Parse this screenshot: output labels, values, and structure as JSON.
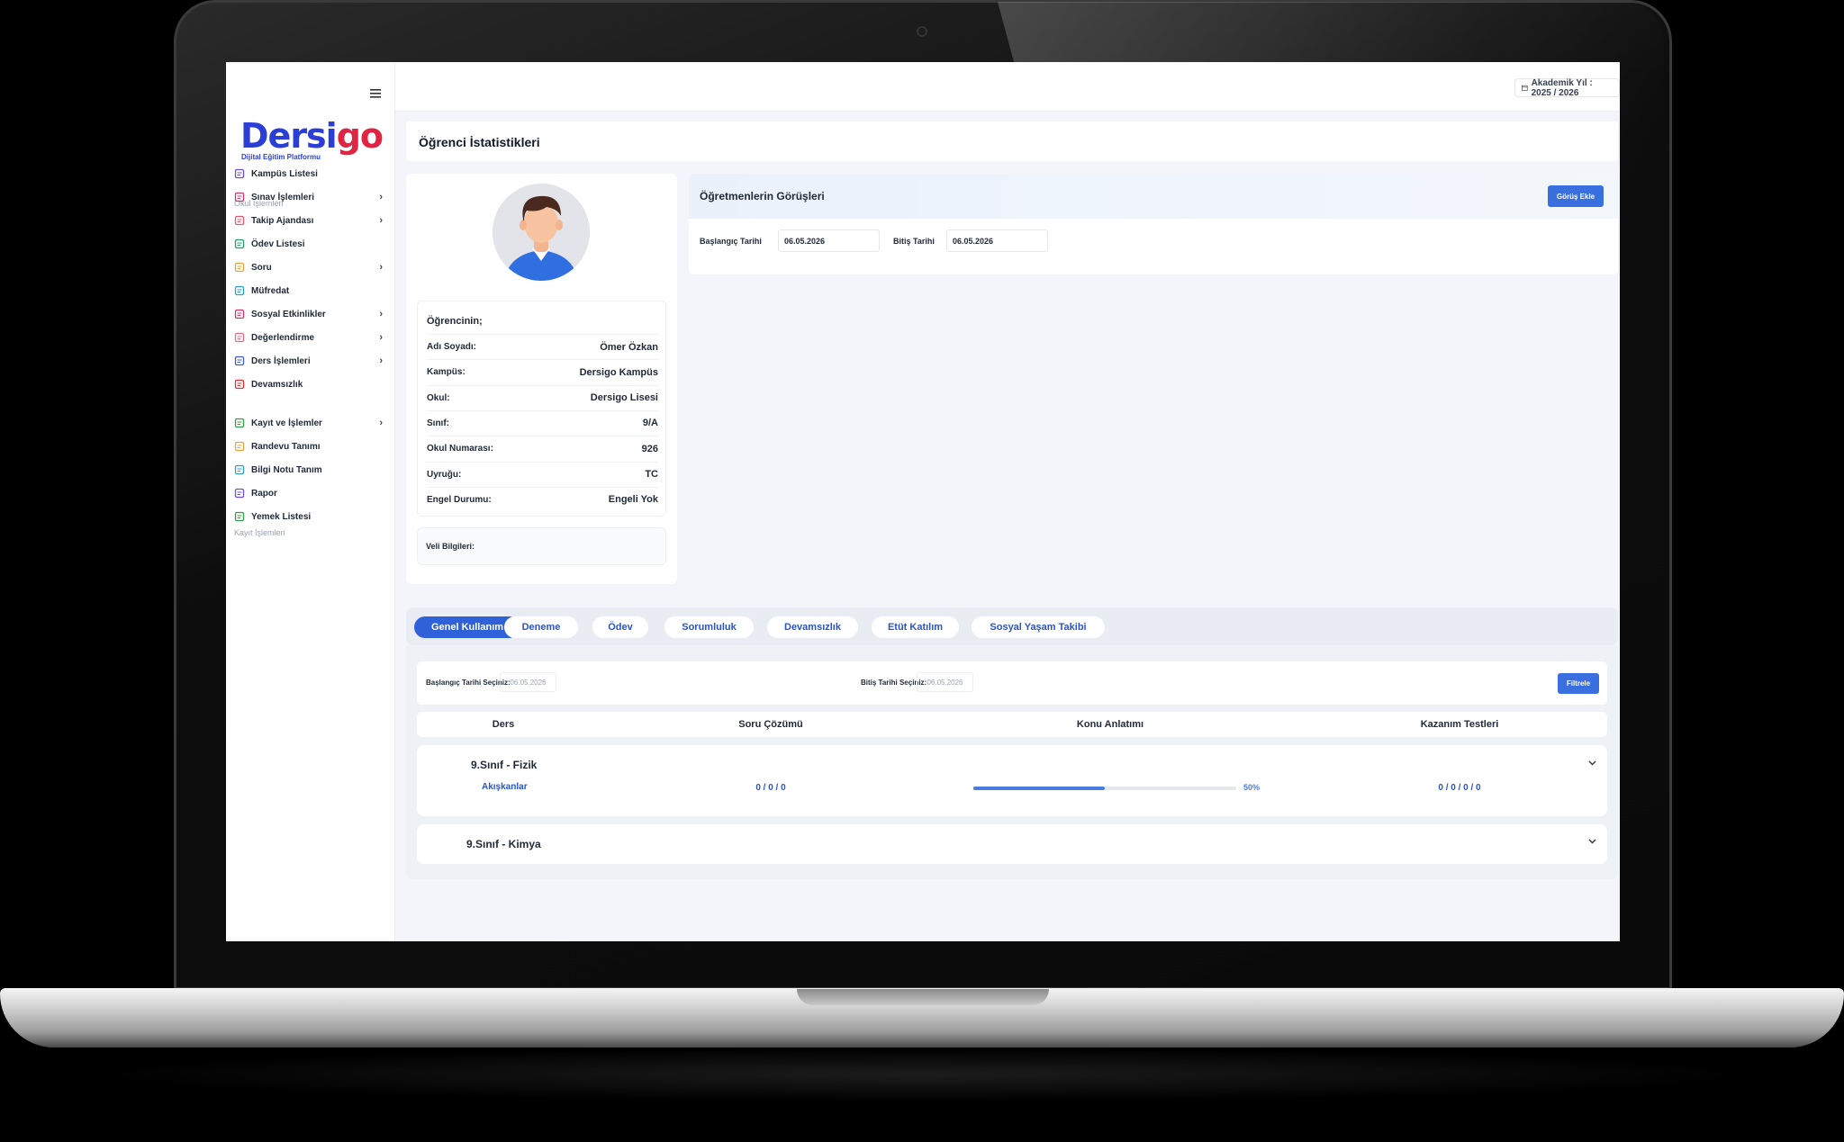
{
  "colors": {
    "brand_blue": "#2b3fd6",
    "brand_red": "#e02443",
    "primary": "#2f62d8"
  },
  "logo": {
    "part1": "Dersi",
    "part2": "go",
    "subtitle": "Dijital Eğitim Platformu"
  },
  "sidebar": {
    "section_school": "Okul İşlemleri",
    "section_registration": "Kayıt İşlemleri",
    "items": [
      {
        "label": "Kampüs Listesi",
        "icon": "building-icon",
        "chevron": false
      },
      {
        "label": "Sınav İşlemleri",
        "icon": "exam-icon",
        "chevron": true
      },
      {
        "label": "Takip Ajandası",
        "icon": "list-icon",
        "chevron": true
      },
      {
        "label": "Ödev Listesi",
        "icon": "homework-icon",
        "chevron": false
      },
      {
        "label": "Soru",
        "icon": "question-icon",
        "chevron": true
      },
      {
        "label": "Müfredat",
        "icon": "curriculum-icon",
        "chevron": false
      },
      {
        "label": "Sosyal Etkinlikler",
        "icon": "calendar-icon",
        "chevron": true
      },
      {
        "label": "Değerlendirme",
        "icon": "edit-icon",
        "chevron": true
      },
      {
        "label": "Ders İşlemleri",
        "icon": "book-icon",
        "chevron": true
      },
      {
        "label": "Devamsızlık",
        "icon": "absence-icon",
        "chevron": false
      },
      {
        "label": "Kayıt ve İşlemler",
        "icon": "user-add-icon",
        "chevron": true
      },
      {
        "label": "Randevu Tanımı",
        "icon": "appointment-icon",
        "chevron": false
      },
      {
        "label": "Bilgi Notu Tanım",
        "icon": "note-icon",
        "chevron": false
      },
      {
        "label": "Rapor",
        "icon": "report-icon",
        "chevron": false
      },
      {
        "label": "Yemek Listesi",
        "icon": "food-icon",
        "chevron": false
      }
    ]
  },
  "topbar": {
    "academic_year": "Akademik Yıl : 2025 / 2026"
  },
  "page": {
    "title": "Öğrenci İstatistikleri"
  },
  "student": {
    "heading": "Öğrencinin;",
    "rows": [
      {
        "label": "Adı Soyadı:",
        "value": "Ömer Özkan"
      },
      {
        "label": "Kampüs:",
        "value": "Dersigo Kampüs"
      },
      {
        "label": "Okul:",
        "value": "Dersigo Lisesi"
      },
      {
        "label": "Sınıf:",
        "value": "9/A"
      },
      {
        "label": "Okul Numarası:",
        "value": "926"
      },
      {
        "label": "Uyruğu:",
        "value": "TC"
      },
      {
        "label": "Engel Durumu:",
        "value": "Engeli Yok"
      }
    ],
    "parent_label": "Veli Bilgileri:"
  },
  "opinions": {
    "title": "Öğretmenlerin Görüşleri",
    "add_button": "Görüş Ekle",
    "start_label": "Başlangıç Tarihi",
    "start_value": "06.05.2026",
    "end_label": "Bitiş Tarihi",
    "end_value": "06.05.2026"
  },
  "tabs": [
    "Genel Kullanım",
    "Deneme",
    "Ödev",
    "Sorumluluk",
    "Devamsızlık",
    "Etüt Katılım",
    "Sosyal Yaşam Takibi"
  ],
  "filter": {
    "start_label": "Başlangıç Tarihi Seçiniz:",
    "start_value": "06.05.2026",
    "end_label": "Bitiş Tarihi Seçiniz:",
    "end_value": "06.05.2026",
    "button": "Filtrele"
  },
  "table": {
    "headers": [
      "Ders",
      "Soru Çözümü",
      "Konu Anlatımı",
      "Kazanım Testleri"
    ],
    "courses": [
      {
        "title": "9.Sınıf - Fizik",
        "expanded": true,
        "subject": "Akışkanlar",
        "question_solving": "0 / 0 / 0",
        "topic_progress": 0.5,
        "topic_progress_label": "50%",
        "achievement_tests": "0 / 0 / 0 / 0"
      },
      {
        "title": "9.Sınıf - Kimya",
        "expanded": false
      }
    ]
  }
}
